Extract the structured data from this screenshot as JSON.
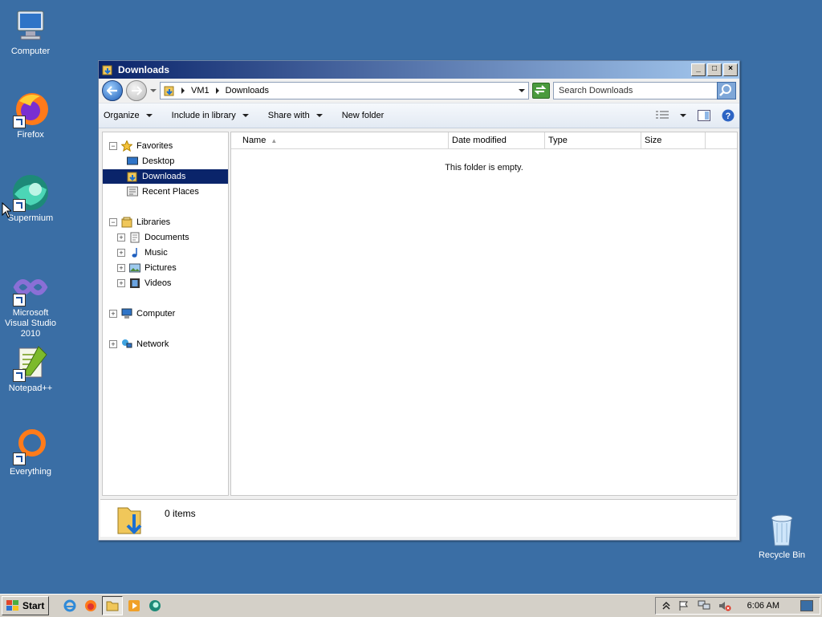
{
  "desktop": {
    "icons": [
      {
        "label": "Computer"
      },
      {
        "label": "Firefox"
      },
      {
        "label": "Supermium"
      },
      {
        "label": "Microsoft Visual Studio 2010"
      },
      {
        "label": "Notepad++"
      },
      {
        "label": "Everything"
      },
      {
        "label": "Recycle Bin"
      }
    ]
  },
  "window": {
    "title": "Downloads",
    "address": {
      "crumbs": [
        "VM1",
        "Downloads"
      ]
    },
    "search": {
      "placeholder": "Search Downloads"
    },
    "toolbar": {
      "organize": "Organize",
      "include_in_library": "Include in library",
      "share_with": "Share with",
      "new_folder": "New folder"
    },
    "nav": {
      "favorites": "Favorites",
      "desktop": "Desktop",
      "downloads": "Downloads",
      "recent_places": "Recent Places",
      "libraries": "Libraries",
      "documents": "Documents",
      "music": "Music",
      "pictures": "Pictures",
      "videos": "Videos",
      "computer": "Computer",
      "network": "Network"
    },
    "columns": {
      "name": "Name",
      "date_modified": "Date modified",
      "type": "Type",
      "size": "Size"
    },
    "empty_message": "This folder is empty.",
    "status": {
      "item_count": "0 items"
    }
  },
  "taskbar": {
    "start_label": "Start",
    "clock": "6:06 AM"
  }
}
